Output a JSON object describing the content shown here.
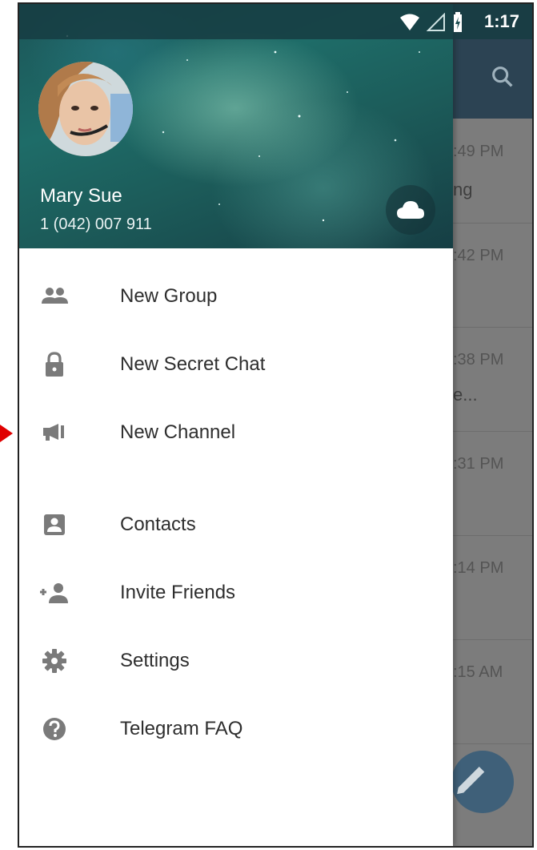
{
  "status_bar": {
    "time": "1:17"
  },
  "user": {
    "name": "Mary Sue",
    "phone": "1 (042) 007 911"
  },
  "menu": {
    "items": [
      {
        "label": "New Group",
        "icon": "group-icon"
      },
      {
        "label": "New Secret Chat",
        "icon": "lock-icon"
      },
      {
        "label": "New Channel",
        "icon": "megaphone-icon"
      },
      {
        "label": "Contacts",
        "icon": "contact-card-icon"
      },
      {
        "label": "Invite Friends",
        "icon": "person-add-icon"
      },
      {
        "label": "Settings",
        "icon": "gear-icon"
      },
      {
        "label": "Telegram FAQ",
        "icon": "help-icon"
      }
    ]
  },
  "background_chats": {
    "times": [
      ":49 PM",
      ":42 PM",
      ":38 PM",
      ":31 PM",
      ":14 PM",
      ":15 AM"
    ],
    "snippets": [
      "ng",
      "",
      "e...",
      "",
      "",
      ""
    ]
  },
  "colors": {
    "toolbar": "#2c4353",
    "accent_fab": "#3f6079",
    "arrow": "#e00000"
  }
}
